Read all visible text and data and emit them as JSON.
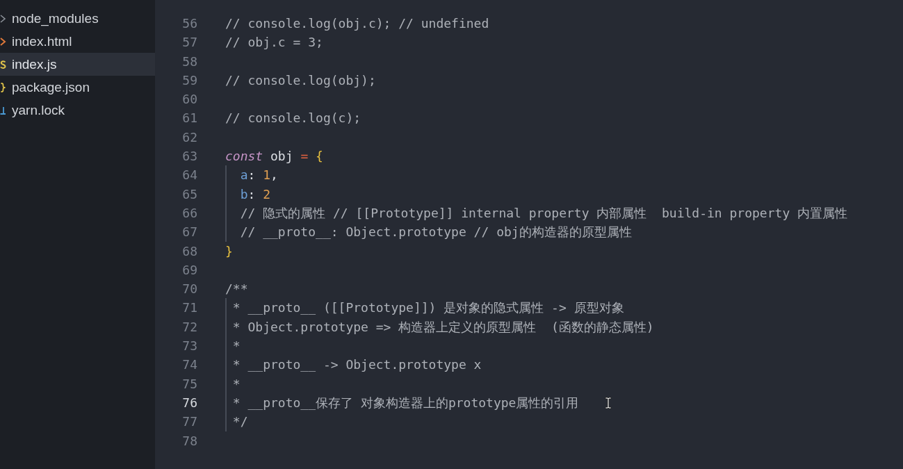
{
  "sidebar": {
    "files": [
      {
        "name": "node_modules",
        "kind": "folder",
        "selected": false
      },
      {
        "name": "index.html",
        "kind": "html",
        "selected": false
      },
      {
        "name": "index.js",
        "kind": "js",
        "selected": true
      },
      {
        "name": "package.json",
        "kind": "json",
        "selected": false
      },
      {
        "name": "yarn.lock",
        "kind": "lock",
        "selected": false
      }
    ]
  },
  "editor": {
    "lines": [
      {
        "number": "56",
        "current": false,
        "tokens": [
          {
            "kind": "comment",
            "text": "// console.log(obj.c); // undefined"
          }
        ]
      },
      {
        "number": "57",
        "current": false,
        "tokens": [
          {
            "kind": "comment",
            "text": "// obj.c = 3;"
          }
        ]
      },
      {
        "number": "58",
        "current": false
      },
      {
        "number": "59",
        "current": false,
        "tokens": [
          {
            "kind": "comment",
            "text": "// console.log(obj);"
          }
        ]
      },
      {
        "number": "60",
        "current": false
      },
      {
        "number": "61",
        "current": false,
        "tokens": [
          {
            "kind": "comment",
            "text": "// console.log(c);"
          }
        ]
      },
      {
        "number": "62",
        "current": false
      },
      {
        "number": "63",
        "current": false,
        "tokens": [
          {
            "kind": "keyword",
            "text": "const"
          },
          {
            "kind": "plain",
            "text": " obj "
          },
          {
            "kind": "operator",
            "text": "="
          },
          {
            "kind": "bracket",
            "text": " {"
          }
        ]
      },
      {
        "number": "64",
        "current": false,
        "indent_guide": true,
        "tokens": [
          {
            "kind": "property",
            "text": "  a"
          },
          {
            "kind": "plain",
            "text": ": "
          },
          {
            "kind": "number",
            "text": "1"
          },
          {
            "kind": "plain",
            "text": ","
          }
        ]
      },
      {
        "number": "65",
        "current": false,
        "indent_guide": true,
        "tokens": [
          {
            "kind": "property",
            "text": "  b"
          },
          {
            "kind": "plain",
            "text": ": "
          },
          {
            "kind": "number",
            "text": "2"
          }
        ]
      },
      {
        "number": "66",
        "current": false,
        "indent_guide": true,
        "tokens": [
          {
            "kind": "comment",
            "text": "  // 隐式的属性 // [[Prototype]] internal property 内部属性  build-in property 内置属性"
          }
        ]
      },
      {
        "number": "67",
        "current": false,
        "indent_guide": true,
        "tokens": [
          {
            "kind": "comment",
            "text": "  // __proto__: Object.prototype // obj的构造器的原型属性"
          }
        ]
      },
      {
        "number": "68",
        "current": false,
        "tokens": [
          {
            "kind": "bracket",
            "text": "}"
          }
        ]
      },
      {
        "number": "69",
        "current": false
      },
      {
        "number": "70",
        "current": false,
        "tokens": [
          {
            "kind": "comment",
            "text": "/**"
          }
        ]
      },
      {
        "number": "71",
        "current": false,
        "indent_guide": true,
        "tokens": [
          {
            "kind": "comment",
            "text": " * __proto__ ([[Prototype]]) 是对象的隐式属性 -> 原型对象"
          }
        ]
      },
      {
        "number": "72",
        "current": false,
        "indent_guide": true,
        "tokens": [
          {
            "kind": "comment",
            "text": " * Object.prototype => 构造器上定义的原型属性  (函数的静态属性)"
          }
        ]
      },
      {
        "number": "73",
        "current": false,
        "indent_guide": true,
        "tokens": [
          {
            "kind": "comment",
            "text": " *"
          }
        ]
      },
      {
        "number": "74",
        "current": false,
        "indent_guide": true,
        "tokens": [
          {
            "kind": "comment",
            "text": " * __proto__ -> Object.prototype x"
          }
        ]
      },
      {
        "number": "75",
        "current": false,
        "indent_guide": true,
        "tokens": [
          {
            "kind": "comment",
            "text": " *"
          }
        ]
      },
      {
        "number": "76",
        "current": true,
        "indent_guide": true,
        "tokens": [
          {
            "kind": "comment",
            "text": " * __proto__保存了 对象构造器上的prototype属性的引用"
          }
        ]
      },
      {
        "number": "77",
        "current": false,
        "indent_guide": true,
        "tokens": [
          {
            "kind": "comment",
            "text": " */"
          }
        ]
      },
      {
        "number": "78",
        "current": false
      }
    ]
  }
}
